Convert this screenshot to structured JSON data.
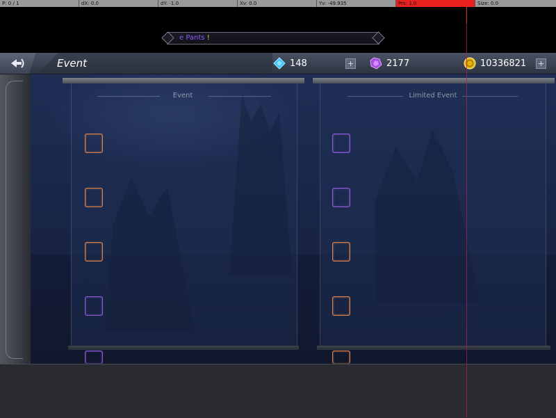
{
  "debug_bar": {
    "cells": [
      "P: 0 / 1",
      "dX: 0.0",
      "dY: -1.0",
      "Xv: 0.0",
      "Yv: -49.935",
      "Prs: 1.0",
      "Size: 0.0"
    ]
  },
  "marquee": {
    "text": "e Pants",
    "suffix": "!"
  },
  "header": {
    "title": "Event",
    "currencies": [
      {
        "name": "diamond",
        "value": "148"
      },
      {
        "name": "crystal",
        "value": "2177"
      },
      {
        "name": "gold",
        "value": "10336821"
      }
    ]
  },
  "panels": [
    {
      "heading": "Event"
    },
    {
      "heading": "Limited Event"
    }
  ],
  "colors": {
    "slot_orange": "#d8824a",
    "slot_purple": "#8d5ad8",
    "accent_text": "#8b5cf6"
  }
}
